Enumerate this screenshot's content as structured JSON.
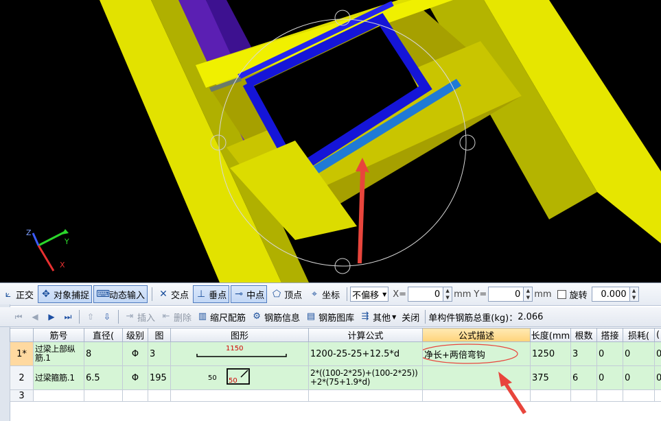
{
  "viewport": {
    "axes": {
      "z": "Z",
      "y": "Y",
      "x": "X"
    }
  },
  "snap_toolbar": {
    "ortho": "正交",
    "object_snap": "对象捕捉",
    "dynamic_input": "动态输入",
    "intersection": "交点",
    "perpendicular": "垂点",
    "midpoint": "中点",
    "vertex": "顶点",
    "coordinate": "坐标",
    "offset_mode": "不偏移",
    "x_label": "X=",
    "x_value": "0",
    "x_unit": "mm",
    "y_label": "Y=",
    "y_value": "0",
    "y_unit": "mm",
    "rotate_label": "旋转",
    "rotate_value": "0.000"
  },
  "edit_toolbar": {
    "insert": "插入",
    "delete": "删除",
    "scale_rebar": "缩尺配筋",
    "rebar_info": "钢筋信息",
    "rebar_library": "钢筋图库",
    "other": "其他",
    "close": "关闭",
    "total_weight_label": "单构件钢筋总重(kg)：",
    "total_weight_value": "2.066"
  },
  "table": {
    "headers": [
      "",
      "筋号",
      "直径(",
      "级别",
      "图",
      "图形",
      "计算公式",
      "公式描述",
      "长度(mm",
      "根数",
      "搭接",
      "损耗(",
      "("
    ],
    "rows": [
      {
        "num": "1*",
        "name": "过梁上部纵筋.1",
        "dia": "8",
        "grade": "Φ",
        "fig": "3",
        "shape_text": "1150",
        "formula": "1200-25-25+12.5*d",
        "desc": "净长+两倍弯钩",
        "length": "1250",
        "count": "3",
        "lap": "0",
        "loss": "0",
        "extra": "0"
      },
      {
        "num": "2",
        "name": "过梁箍筋.1",
        "dia": "6.5",
        "grade": "Φ",
        "fig": "195",
        "shape_text": "50",
        "shape_text2": "50",
        "formula": "2*((100-2*25)+(100-2*25))+2*(75+1.9*d)",
        "desc": "",
        "length": "375",
        "count": "6",
        "lap": "0",
        "loss": "0",
        "extra": "0"
      },
      {
        "num": "3"
      }
    ]
  },
  "colors": {
    "beam_yellow": "#e6e600",
    "rebar_blue": "#1a1ad9",
    "annotation_red": "#e8453c",
    "row_green": "#d6f5d6"
  }
}
